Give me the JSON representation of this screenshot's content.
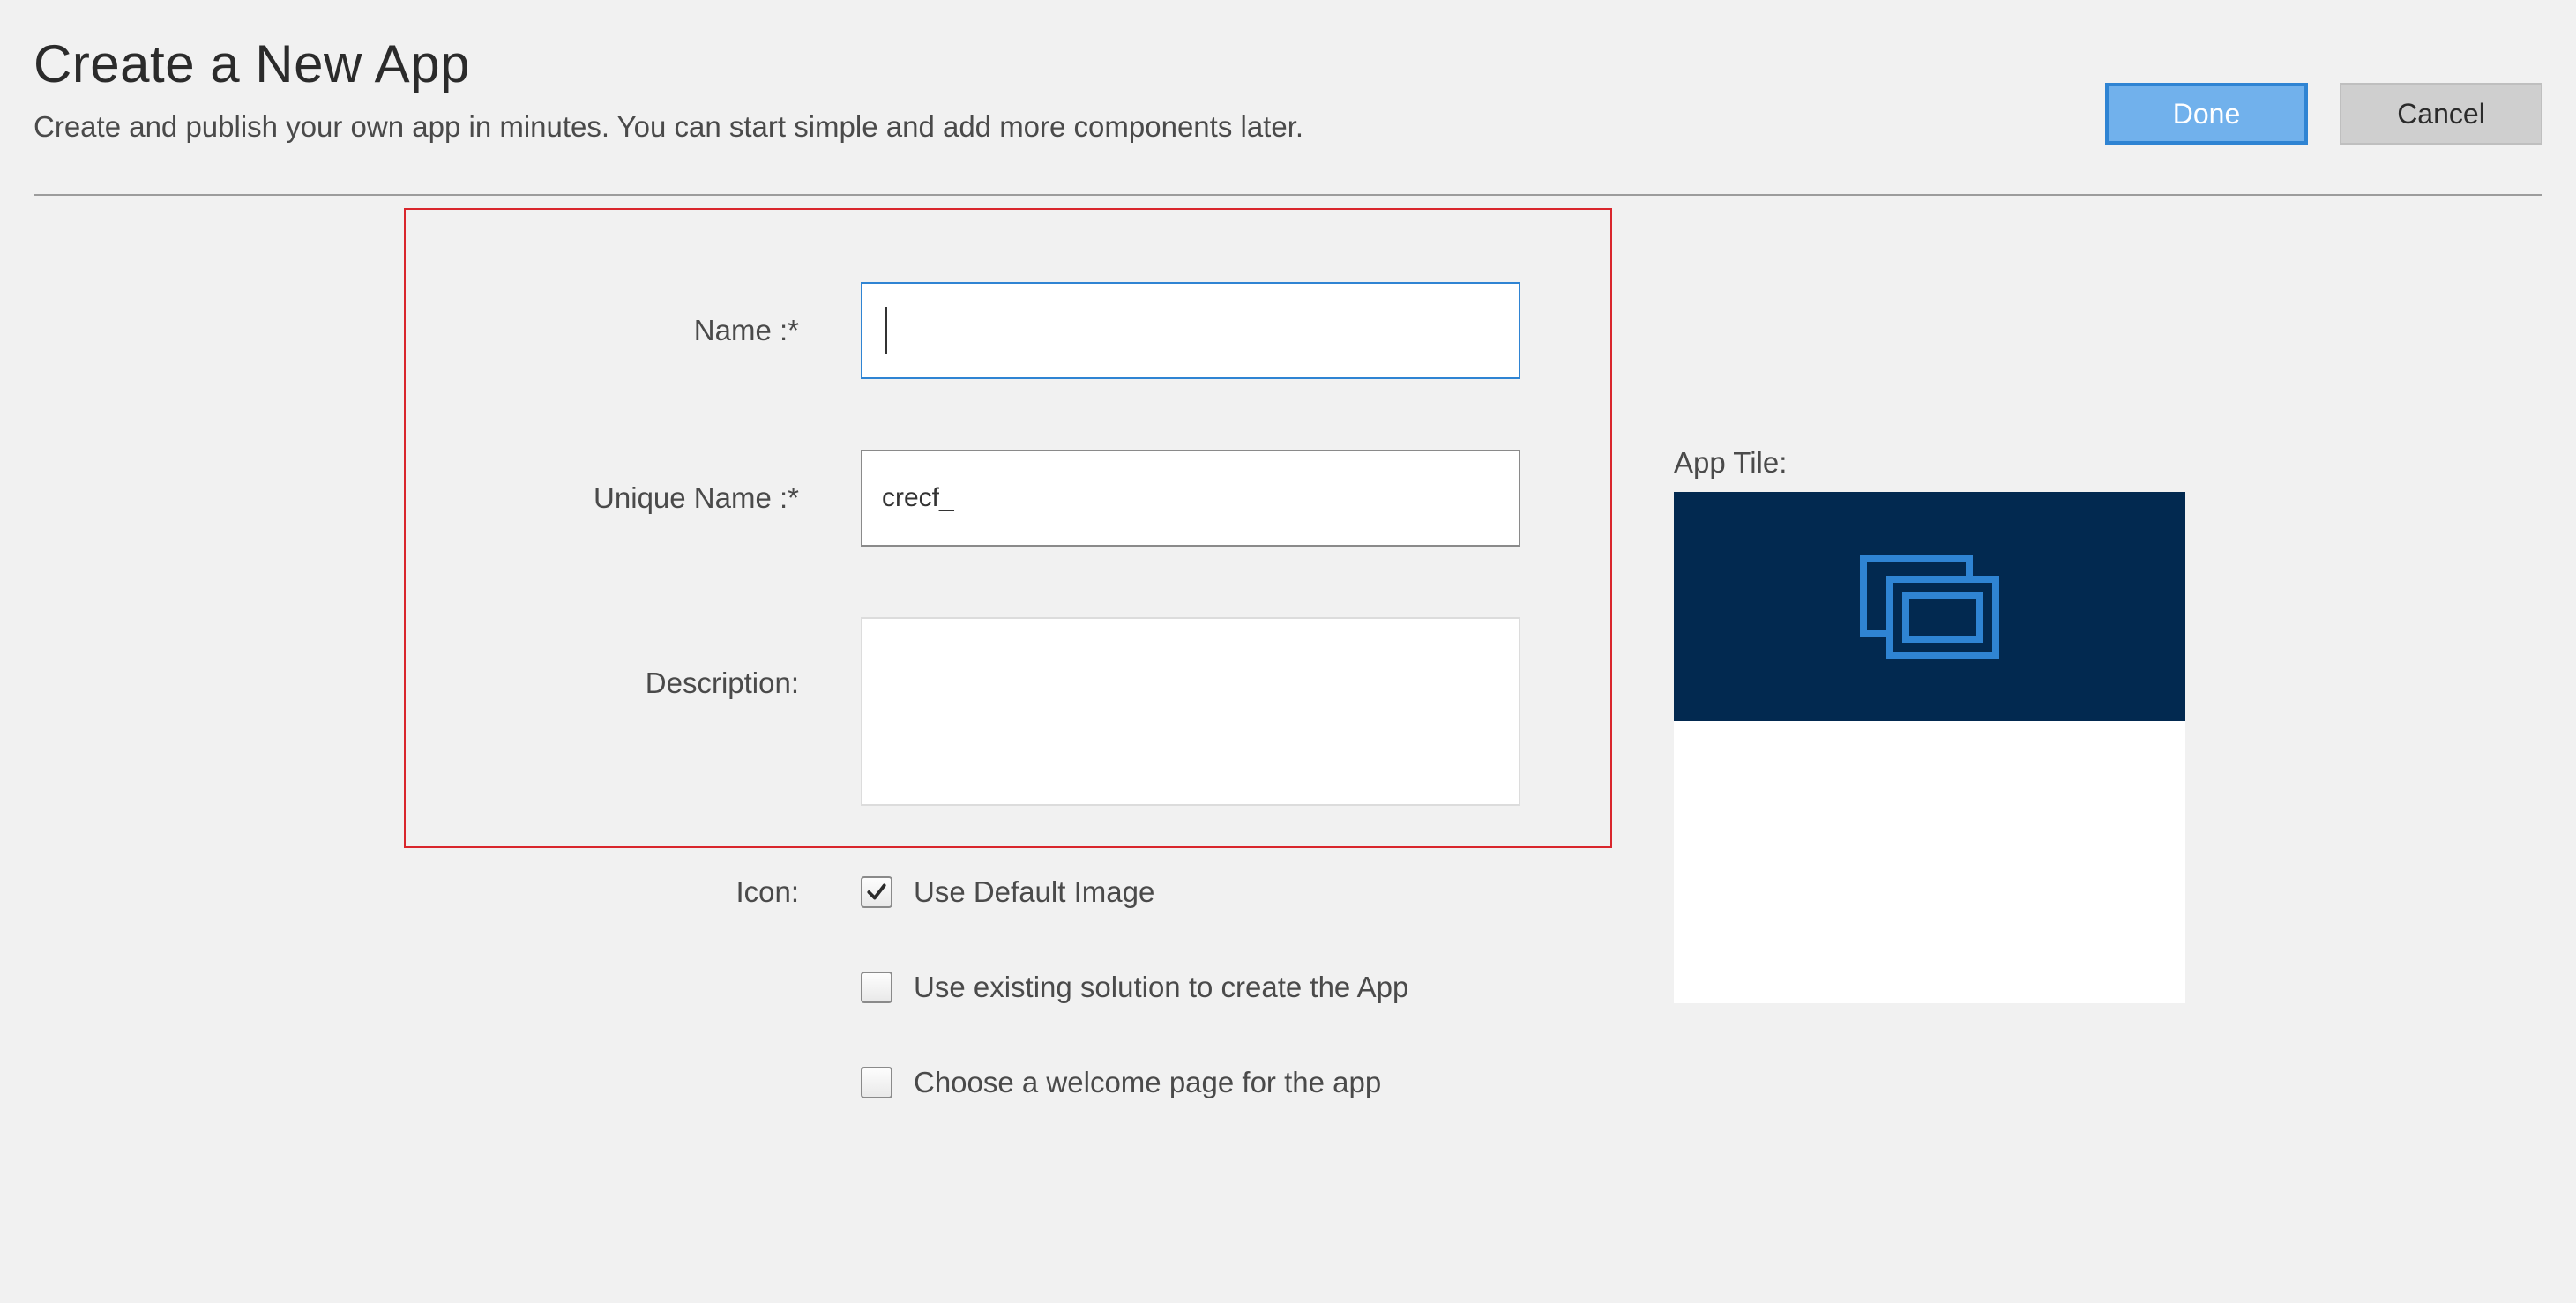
{
  "header": {
    "title": "Create a New App",
    "subtitle": "Create and publish your own app in minutes. You can start simple and add more components later."
  },
  "buttons": {
    "done": "Done",
    "cancel": "Cancel"
  },
  "form": {
    "name_label": "Name :*",
    "name_value": "",
    "unique_name_label": "Unique Name :*",
    "unique_name_value": "crecf_",
    "description_label": "Description:",
    "description_value": "",
    "icon_label": "Icon:",
    "use_default_image": "Use Default Image",
    "use_default_image_checked": true,
    "use_existing_solution": "Use existing solution to create the App",
    "use_existing_solution_checked": false,
    "choose_welcome_page": "Choose a welcome page for the app",
    "choose_welcome_page_checked": false
  },
  "tile": {
    "label": "App Tile:",
    "bg_color": "#022950",
    "icon_color": "#2f84d3"
  }
}
